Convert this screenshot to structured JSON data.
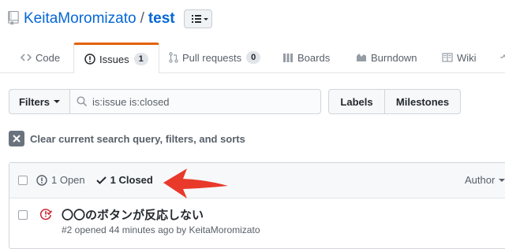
{
  "repo": {
    "owner": "KeitaMoromizato",
    "separator": "/",
    "name": "test"
  },
  "tabs": [
    {
      "label": "Code",
      "icon": "code-icon"
    },
    {
      "label": "Issues",
      "icon": "issue-opened-icon",
      "count": "1",
      "selected": true
    },
    {
      "label": "Pull requests",
      "icon": "git-pull-request-icon",
      "count": "0"
    },
    {
      "label": "Boards",
      "icon": "boards-icon"
    },
    {
      "label": "Burndown",
      "icon": "graph-icon"
    },
    {
      "label": "Wiki",
      "icon": "book-icon"
    }
  ],
  "filters": {
    "label": "Filters",
    "search_value": "is:issue is:closed"
  },
  "buttons": {
    "labels": "Labels",
    "milestones": "Milestones"
  },
  "clear_query": "Clear current search query, filters, and sorts",
  "issues_header": {
    "open": "1 Open",
    "closed": "1 Closed",
    "author": "Author"
  },
  "issue": {
    "title": "〇〇のボタンが反応しない",
    "meta": "#2 opened 44 minutes ago by KeitaMoromizato"
  },
  "colors": {
    "link": "#0366d6",
    "tab_accent": "#e36209",
    "closed_issue_icon": "#cb2431",
    "arrow": "#e8392b"
  }
}
